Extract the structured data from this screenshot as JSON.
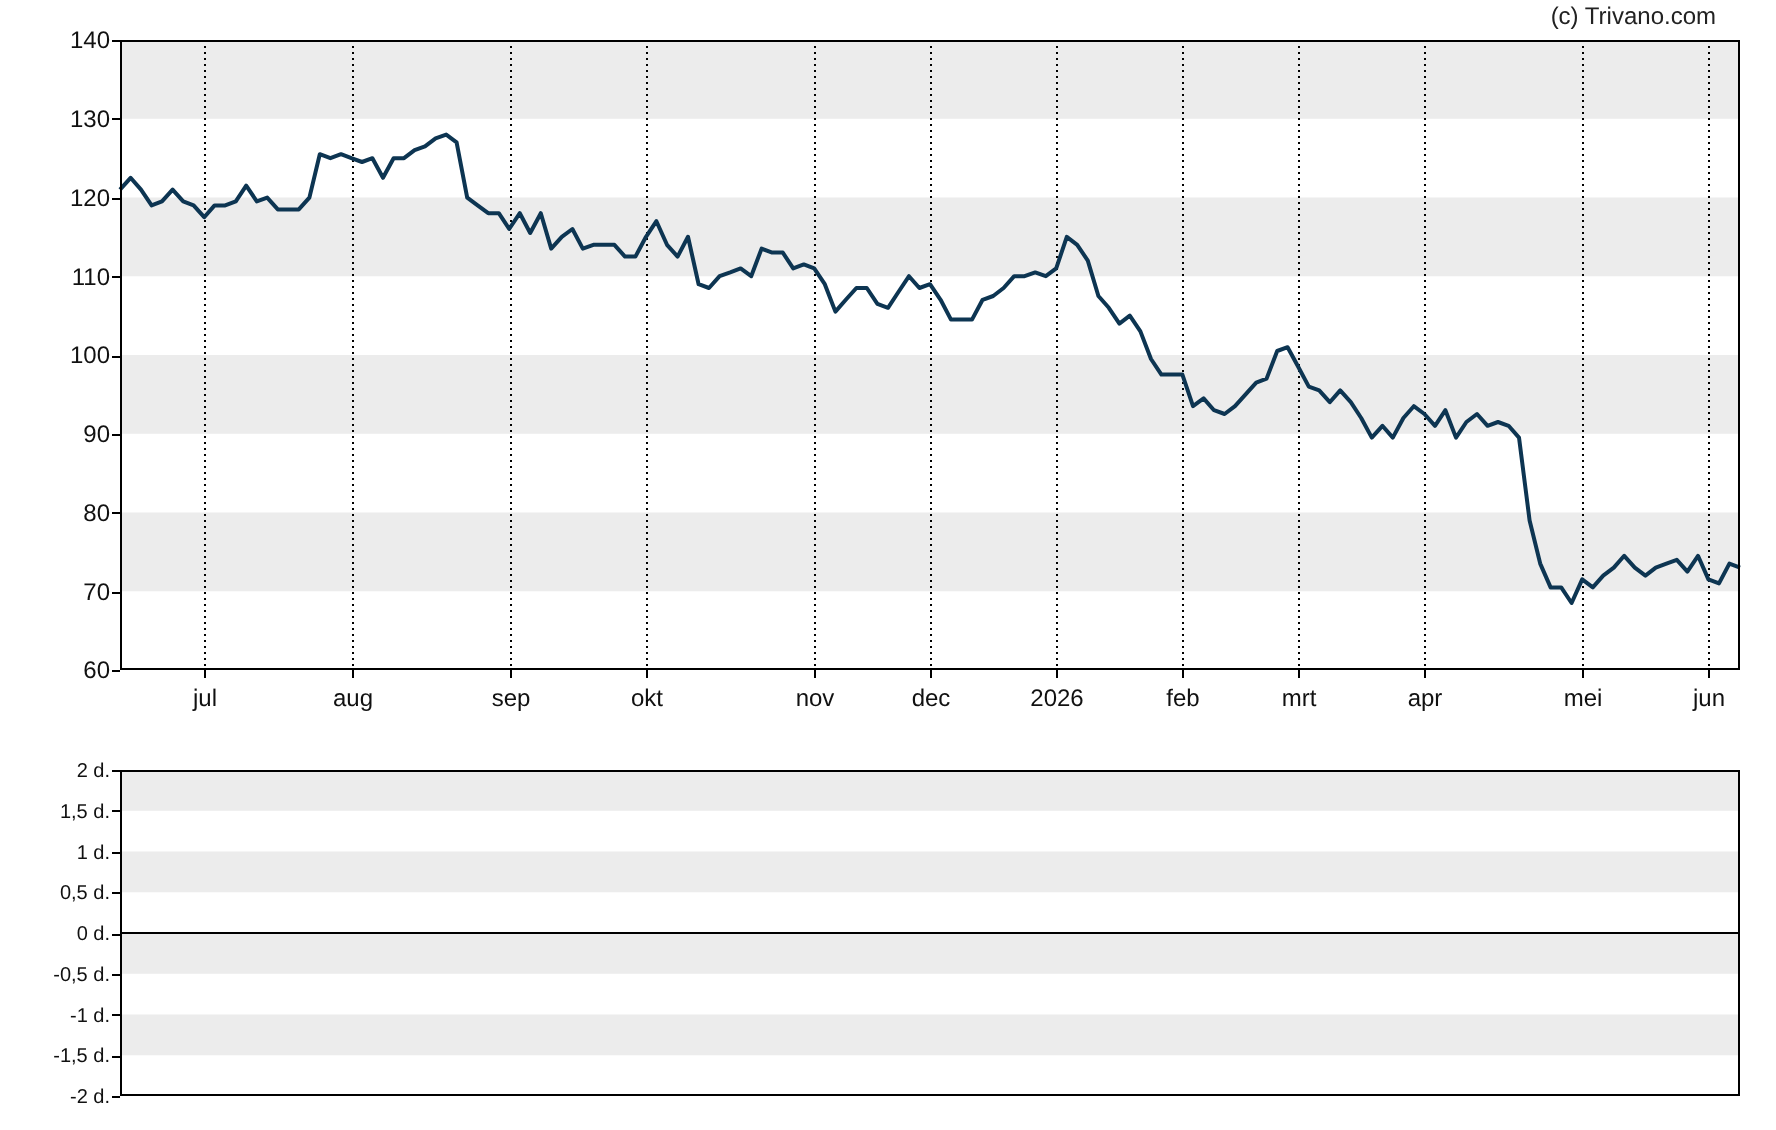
{
  "credit": "(c) Trivano.com",
  "price_chart": {
    "chart_data": {
      "type": "line",
      "ylim": [
        60,
        140
      ],
      "yticks": [
        60,
        70,
        80,
        90,
        100,
        110,
        120,
        130,
        140
      ],
      "categories": [
        null,
        null,
        null,
        null,
        null,
        null,
        null,
        null,
        "jul",
        null,
        null,
        null,
        null,
        null,
        null,
        null,
        null,
        null,
        null,
        null,
        null,
        null,
        "aug",
        null,
        null,
        null,
        null,
        null,
        null,
        null,
        null,
        null,
        null,
        null,
        null,
        null,
        null,
        "sep",
        null,
        null,
        null,
        null,
        null,
        null,
        null,
        null,
        null,
        null,
        null,
        null,
        "okt",
        null,
        null,
        null,
        null,
        null,
        null,
        null,
        null,
        null,
        null,
        null,
        null,
        null,
        null,
        null,
        "nov",
        null,
        null,
        null,
        null,
        null,
        null,
        null,
        null,
        null,
        null,
        "dec",
        null,
        null,
        null,
        null,
        null,
        null,
        null,
        null,
        null,
        null,
        null,
        "2026",
        null,
        null,
        null,
        null,
        null,
        null,
        null,
        null,
        null,
        null,
        null,
        "feb",
        null,
        null,
        null,
        null,
        null,
        null,
        null,
        null,
        null,
        null,
        "mrt",
        null,
        null,
        null,
        null,
        null,
        null,
        null,
        null,
        null,
        null,
        null,
        "apr",
        null,
        null,
        null,
        null,
        null,
        null,
        null,
        null,
        null,
        null,
        null,
        null,
        null,
        null,
        "mei",
        null,
        null,
        null,
        null,
        null,
        null,
        null,
        null,
        null,
        null,
        null,
        "jun",
        null,
        null,
        null
      ],
      "series": [
        {
          "color": "#0d3552",
          "values": [
            121,
            122.5,
            121,
            119,
            119.5,
            121,
            119.5,
            119,
            117.5,
            119,
            119,
            119.5,
            121.5,
            119.5,
            120,
            118.5,
            118.5,
            118.5,
            120,
            125.5,
            125,
            125.5,
            125,
            124.5,
            125,
            122.5,
            125,
            125,
            126,
            126.5,
            127.5,
            128,
            127,
            120,
            119,
            118,
            118,
            116,
            118,
            115.5,
            118,
            113.5,
            115,
            116,
            113.5,
            114,
            114,
            114,
            112.5,
            112.5,
            115,
            117,
            114,
            112.5,
            115,
            109,
            108.5,
            110,
            110.5,
            111,
            110,
            113.5,
            113,
            113,
            111,
            111.5,
            111,
            109,
            105.5,
            107,
            108.5,
            108.5,
            106.5,
            106,
            108,
            110,
            108.5,
            109,
            107,
            104.5,
            104.5,
            104.5,
            107,
            107.5,
            108.5,
            110,
            110,
            110.5,
            110,
            111,
            115,
            114,
            112,
            107.5,
            106,
            104,
            105,
            103,
            99.5,
            97.5,
            97.5,
            97.5,
            93.5,
            94.5,
            93,
            92.5,
            93.5,
            95,
            96.5,
            97,
            100.5,
            101,
            98.5,
            96,
            95.5,
            94,
            95.5,
            94,
            92,
            89.5,
            91,
            89.5,
            92,
            93.5,
            92.5,
            91,
            93,
            89.5,
            91.5,
            92.5,
            91,
            91.5,
            91,
            89.5,
            79,
            73.5,
            70.5,
            70.5,
            68.5,
            71.5,
            70.5,
            72,
            73,
            74.5,
            73,
            72,
            73,
            73.5,
            74,
            72.5,
            74.5,
            71.5,
            71,
            73.5,
            73
          ]
        }
      ]
    }
  },
  "dividend_chart": {
    "chart_data": {
      "type": "bar",
      "ylim": [
        -2,
        2
      ],
      "categories": [
        null,
        null
      ],
      "yticks": [
        {
          "value": -2,
          "label": "-2 d."
        },
        {
          "value": -1.5,
          "label": "-1,5 d."
        },
        {
          "value": -1,
          "label": "-1 d."
        },
        {
          "value": -0.5,
          "label": "-0,5 d."
        },
        {
          "value": 0,
          "label": "0 d."
        },
        {
          "value": 0.5,
          "label": "0,5 d."
        },
        {
          "value": 1,
          "label": "1 d."
        },
        {
          "value": 1.5,
          "label": "1,5 d."
        },
        {
          "value": 2,
          "label": "2 d."
        }
      ]
    }
  }
}
